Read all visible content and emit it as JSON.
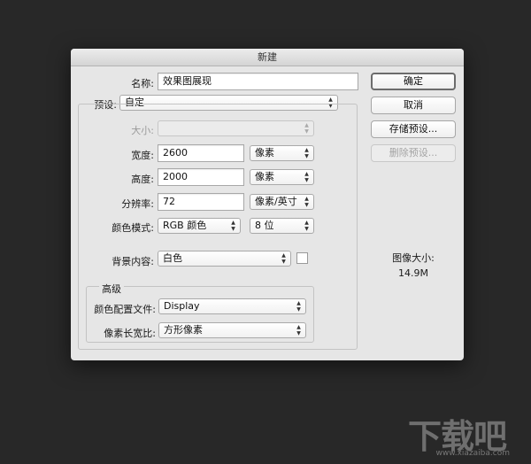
{
  "dialog": {
    "title": "新建",
    "name_label": "名称:",
    "name_value": "效果图展现",
    "preset_label": "预设:",
    "preset_value": "自定",
    "size_label": "大小:",
    "size_value": "",
    "width_label": "宽度:",
    "width_value": "2600",
    "width_unit": "像素",
    "height_label": "高度:",
    "height_value": "2000",
    "height_unit": "像素",
    "resolution_label": "分辨率:",
    "resolution_value": "72",
    "resolution_unit": "像素/英寸",
    "color_mode_label": "颜色模式:",
    "color_mode_value": "RGB 颜色",
    "bit_depth_value": "8 位",
    "background_label": "背景内容:",
    "background_value": "白色",
    "advanced_label": "高级",
    "color_profile_label": "颜色配置文件:",
    "color_profile_value": "Display",
    "pixel_aspect_label": "像素长宽比:",
    "pixel_aspect_value": "方形像素",
    "image_size_label": "图像大小:",
    "image_size_value": "14.9M"
  },
  "buttons": {
    "ok": "确定",
    "cancel": "取消",
    "save_preset": "存储预设...",
    "delete_preset": "删除预设..."
  },
  "watermark": {
    "text": "下载吧",
    "url": "www.xiazaiba.com"
  },
  "colors": {
    "background": "#282828",
    "dialog": "#e6e6e6"
  }
}
